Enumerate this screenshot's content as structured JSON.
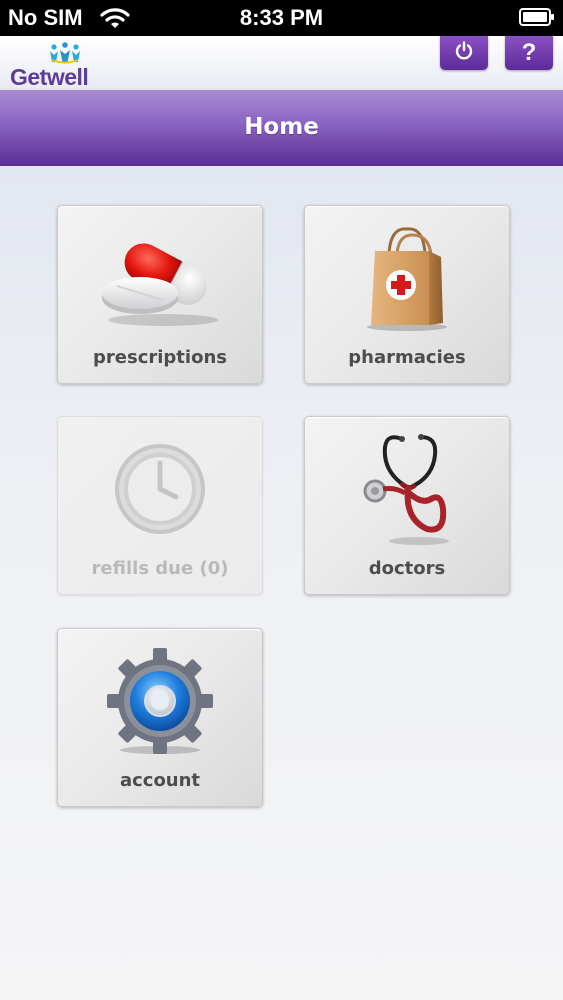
{
  "status_bar": {
    "carrier": "No SIM",
    "time": "8:33 PM",
    "wifi_icon": "wifi-icon",
    "battery_icon": "battery-icon"
  },
  "header": {
    "logo_text": "Getwell",
    "power_icon": "power-icon",
    "help_label": "?",
    "brand_color": "#5b3d9a"
  },
  "title_bar": {
    "title": "Home",
    "color_top": "#a98bd3",
    "color_bottom": "#5b2f95"
  },
  "tiles": [
    {
      "label": "prescriptions",
      "icon": "pills-icon",
      "enabled": true
    },
    {
      "label": "pharmacies",
      "icon": "shopping-bag-icon",
      "enabled": true
    },
    {
      "label": "refills due (0)",
      "icon": "clock-icon",
      "enabled": false
    },
    {
      "label": "doctors",
      "icon": "stethoscope-icon",
      "enabled": true
    },
    {
      "label": "account",
      "icon": "gear-icon",
      "enabled": true
    }
  ]
}
